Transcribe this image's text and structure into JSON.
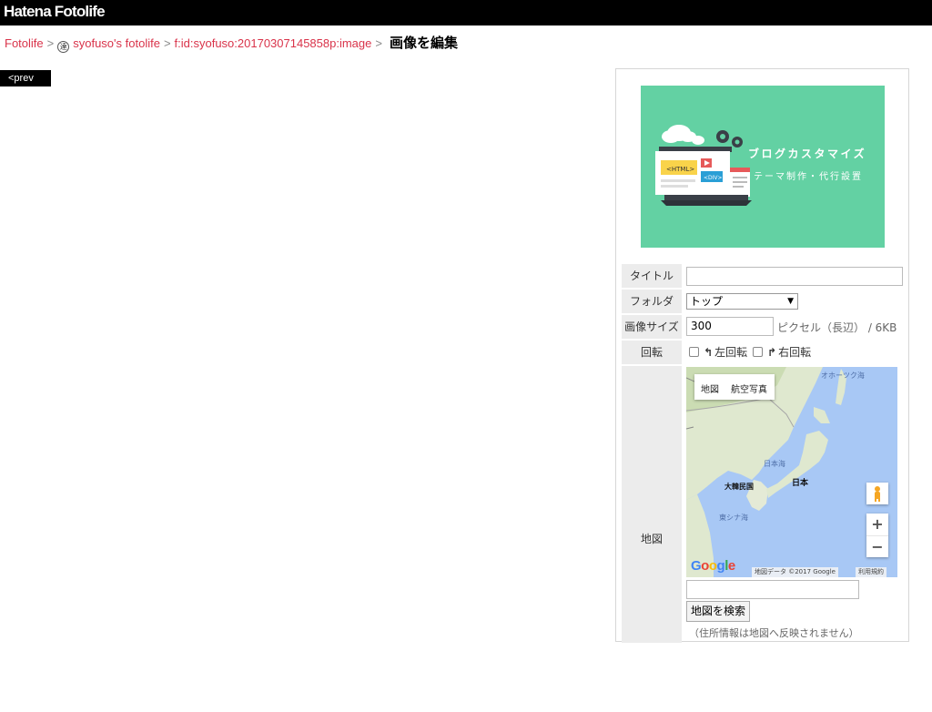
{
  "header": {
    "logo": "Hatena Fotolife"
  },
  "breadcrumb": {
    "root": "Fotolife",
    "sep": ">",
    "user_icon": "user-avatar-icon",
    "user_icon_glyph": "達",
    "user": "syofuso's fotolife",
    "image_id": "f:id:syofuso:20170307145858p:image",
    "current": "画像を編集"
  },
  "nav": {
    "prev": "<prev"
  },
  "thumbnail": {
    "title": "ブログカスタマイズ",
    "subtitle": "テーマ制作・代行設置",
    "html_tag": "<HTML>",
    "div_tag": "<DIV>",
    "bg_color": "#63d1a3"
  },
  "form": {
    "title_label": "タイトル",
    "title_value": "",
    "folder_label": "フォルダ",
    "folder_value": "トップ",
    "size_label": "画像サイズ",
    "size_value": "300",
    "size_unit": "ピクセル（長辺） / 6KB",
    "rotate_label": "回転",
    "rotate_left": "左回転",
    "rotate_right": "右回転",
    "map_label": "地図",
    "map_search_button": "地図を検索",
    "cut_off_text": "（住所情報は地図へ反映されません）"
  },
  "map": {
    "tab_map": "地図",
    "tab_satellite": "航空写真",
    "labels": {
      "okhotsk": "オホーツク海",
      "japan_sea": "日本海",
      "korea": "大韓民国",
      "japan": "日本",
      "east_china_sea": "東シナ海"
    },
    "zoom_in": "+",
    "zoom_out": "−",
    "google": "Google",
    "attribution": "地図データ ©2017 Google",
    "terms": "利用規約"
  }
}
